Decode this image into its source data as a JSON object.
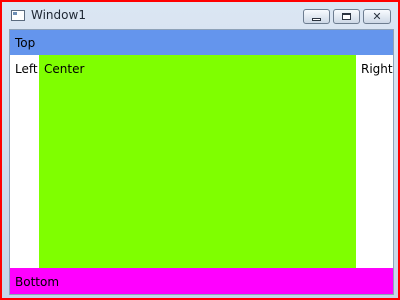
{
  "window": {
    "title": "Window1",
    "icons": {
      "app": "window-app-icon",
      "minimize": "minimize-icon",
      "maximize": "maximize-icon",
      "close": "close-icon"
    },
    "close_glyph": "✕",
    "border_color": "#ff0000"
  },
  "dock": {
    "top": {
      "label": "Top",
      "color": "#6495ed"
    },
    "left": {
      "label": "Left",
      "color": "#ffffff"
    },
    "center": {
      "label": "Center",
      "color": "#7fff00"
    },
    "right": {
      "label": "Right",
      "color": "#ffffff"
    },
    "bottom": {
      "label": "Bottom",
      "color": "#ff00ff"
    }
  }
}
